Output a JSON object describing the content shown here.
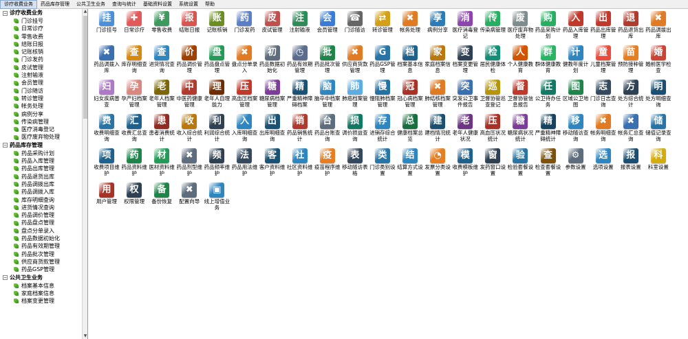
{
  "menubar": [
    {
      "label": "诊疗收费业务",
      "active": true
    },
    {
      "label": "药品库存管理",
      "active": false
    },
    {
      "label": "公共卫生业务",
      "active": false
    },
    {
      "label": "查询与统计",
      "active": false
    },
    {
      "label": "基础资料设置",
      "active": false
    },
    {
      "label": "系统设置",
      "active": false
    },
    {
      "label": "帮助",
      "active": false
    }
  ],
  "sidebar": {
    "groups": [
      {
        "title": "诊疗收费业务",
        "items": [
          "门诊挂号",
          "日常诊疗",
          "零售收费",
          "结账日报",
          "记账核销",
          "门诊发药",
          "皮试管理",
          "注射输液",
          "会员管理",
          "门诊随访",
          "转诊管理",
          "帐务处理",
          "病例分享",
          "传染病管理",
          "医疗消毒登记",
          "医疗废弃物处理"
        ]
      },
      {
        "title": "药品库存管理",
        "items": [
          "药品采购计划",
          "药品入库管理",
          "药品出库管理",
          "药品退货出库",
          "药品调拨出库",
          "药品调拨入库",
          "库存明细查询",
          "进货情况查询",
          "药品调价管理",
          "药品盘点管理",
          "盘点分单录入",
          "药品数据初始化",
          "药品有效期管理",
          "药品批次管理",
          "供应商货款管理",
          "药品GSP管理"
        ]
      },
      {
        "title": "公共卫生业务",
        "items": [
          "档案基本信息",
          "家庭档案信息",
          "档案变更管理"
        ]
      }
    ]
  },
  "tiles": [
    {
      "label": "门诊挂号",
      "icon": "register-icon",
      "color": "#4a90d9",
      "glyph": "挂"
    },
    {
      "label": "日常诊疗",
      "icon": "medical-kit-icon",
      "color": "#e05a5a",
      "glyph": "✚"
    },
    {
      "label": "零售收费",
      "icon": "cash-register-icon",
      "color": "#3c9a5f",
      "glyph": "¥"
    },
    {
      "label": "结账日报",
      "icon": "daily-report-icon",
      "color": "#d9534f",
      "glyph": "报"
    },
    {
      "label": "记账核销",
      "icon": "ledger-icon",
      "color": "#6b8e23",
      "glyph": "账"
    },
    {
      "label": "门诊发药",
      "icon": "pharmacist-icon",
      "color": "#5b7fc7",
      "glyph": "药"
    },
    {
      "label": "皮试管理",
      "icon": "skin-test-icon",
      "color": "#c0504d",
      "glyph": "皮"
    },
    {
      "label": "注射输液",
      "icon": "iv-drip-icon",
      "color": "#2e8b57",
      "glyph": "注"
    },
    {
      "label": "会员管理",
      "icon": "member-icon",
      "color": "#3a7bd5",
      "glyph": "会"
    },
    {
      "label": "门诊随访",
      "icon": "phone-icon",
      "color": "#666666",
      "glyph": "☎"
    },
    {
      "label": "转诊管理",
      "icon": "transfer-icon",
      "color": "#d4a017",
      "glyph": "⇄"
    },
    {
      "label": "帐务处理",
      "icon": "tools-icon",
      "color": "#e07b24",
      "glyph": "✖"
    },
    {
      "label": "病例分享",
      "icon": "share-icon",
      "color": "#2b7bb9",
      "glyph": "享"
    },
    {
      "label": "医疗消毒登记",
      "icon": "disinfect-icon",
      "color": "#8e44ad",
      "glyph": "消"
    },
    {
      "label": "传染病管理",
      "icon": "virus-icon",
      "color": "#27ae60",
      "glyph": "传"
    },
    {
      "label": "医疗废弃物处理",
      "icon": "trash-icon",
      "color": "#7f8c8d",
      "glyph": "废"
    },
    {
      "label": "药品采购计划",
      "icon": "cart-icon",
      "color": "#27ae60",
      "glyph": "购"
    },
    {
      "label": "药品入库管理",
      "icon": "stock-in-icon",
      "color": "#c0392b",
      "glyph": "入"
    },
    {
      "label": "药品出库管理",
      "icon": "stock-out-icon",
      "color": "#c0392b",
      "glyph": "出"
    },
    {
      "label": "药品退货出库",
      "icon": "return-icon",
      "color": "#b03a2e",
      "glyph": "退"
    },
    {
      "label": "药品调拨出库",
      "icon": "tools-icon",
      "color": "#e07b24",
      "glyph": "✖"
    },
    {
      "label": "药品调拨入库",
      "icon": "tools-icon",
      "color": "#3a6fb0",
      "glyph": "✖"
    },
    {
      "label": "库存明细查询",
      "icon": "search-icon",
      "color": "#d68910",
      "glyph": "查"
    },
    {
      "label": "进货情况查询",
      "icon": "search-icon",
      "color": "#2e86c1",
      "glyph": "查"
    },
    {
      "label": "药品调价管理",
      "icon": "price-icon",
      "color": "#a04000",
      "glyph": "价"
    },
    {
      "label": "药品盘点管理",
      "icon": "inventory-icon",
      "color": "#239b56",
      "glyph": "盘"
    },
    {
      "label": "盘点分单录入",
      "icon": "tools-icon",
      "color": "#e07b24",
      "glyph": "✖"
    },
    {
      "label": "药品数据初始化",
      "icon": "init-icon",
      "color": "#5d6d7e",
      "glyph": "初"
    },
    {
      "label": "药品有效期管理",
      "icon": "clock-icon",
      "color": "#5b6c8c",
      "glyph": "◷"
    },
    {
      "label": "药品批次管理",
      "icon": "batch-icon",
      "color": "#1e8449",
      "glyph": "批"
    },
    {
      "label": "供应商货款管理",
      "icon": "supplier-icon",
      "color": "#e07b24",
      "glyph": "✖"
    },
    {
      "label": "药品GSP管理",
      "icon": "gsp-icon",
      "color": "#2874a6",
      "glyph": "G"
    },
    {
      "label": "档案基本信息",
      "icon": "profile-icon",
      "color": "#1f618d",
      "glyph": "档"
    },
    {
      "label": "家庭档案信息",
      "icon": "family-icon",
      "color": "#b9770e",
      "glyph": "家"
    },
    {
      "label": "档案变更管理",
      "icon": "edit-profile-icon",
      "color": "#2e4053",
      "glyph": "变"
    },
    {
      "label": "居民健康体检",
      "icon": "checkup-icon",
      "color": "#148f77",
      "glyph": "检"
    },
    {
      "label": "个人健康教育",
      "icon": "person-icon",
      "color": "#d35400",
      "glyph": "人"
    },
    {
      "label": "群体健康教育",
      "icon": "group-icon",
      "color": "#28b463",
      "glyph": "群"
    },
    {
      "label": "健教年度计划",
      "icon": "plan-icon",
      "color": "#2e86c1",
      "glyph": "计"
    },
    {
      "label": "儿童档案管理",
      "icon": "child-icon",
      "color": "#e74c3c",
      "glyph": "童"
    },
    {
      "label": "预防接种管理",
      "icon": "vaccine-icon",
      "color": "#e67e22",
      "glyph": "苗"
    },
    {
      "label": "婚前医学检查",
      "icon": "wedding-icon",
      "color": "#cb4335",
      "glyph": "婚"
    },
    {
      "label": "妇女疾病普查",
      "icon": "women-icon",
      "color": "#af7ac5",
      "glyph": "妇"
    },
    {
      "label": "孕产妇档案管理",
      "icon": "maternal-icon",
      "color": "#d98880",
      "glyph": "孕"
    },
    {
      "label": "老年人档案管理",
      "icon": "elderly-icon",
      "color": "#7d6608",
      "glyph": "老"
    },
    {
      "label": "中医药健康管理",
      "icon": "tcm-icon",
      "color": "#b03a2e",
      "glyph": "中"
    },
    {
      "label": "老年人自理能力",
      "icon": "elderly-care-icon",
      "color": "#6e2c00",
      "glyph": "理"
    },
    {
      "label": "高血压档案管理",
      "icon": "hypertension-icon",
      "color": "#c0392b",
      "glyph": "压"
    },
    {
      "label": "糖尿病档案管理",
      "icon": "diabetes-icon",
      "color": "#7d3c98",
      "glyph": "糖"
    },
    {
      "label": "严重精神障碍档案",
      "icon": "mental-icon",
      "color": "#1a5276",
      "glyph": "精"
    },
    {
      "label": "脑卒中档案管理",
      "icon": "stroke-icon",
      "color": "#2e86c1",
      "glyph": "脑"
    },
    {
      "label": "肺癌档案管理",
      "icon": "lung-icon",
      "color": "#5dade2",
      "glyph": "肺"
    },
    {
      "label": "慢阻肺档案管理",
      "icon": "copd-icon",
      "color": "#2471a3",
      "glyph": "慢"
    },
    {
      "label": "冠心病档案管理",
      "icon": "heart-icon",
      "color": "#a93226",
      "glyph": "冠"
    },
    {
      "label": "肺结核档案管理",
      "icon": "tb-icon",
      "color": "#e07b24",
      "glyph": "✖"
    },
    {
      "label": "突发公卫事件报告",
      "icon": "emergency-icon",
      "color": "#3a6fb0",
      "glyph": "突"
    },
    {
      "label": "卫督协管巡查登记",
      "icon": "inspect-icon",
      "color": "#b7950b",
      "glyph": "巡"
    },
    {
      "label": "卫督协管信息报告",
      "icon": "report-icon",
      "color": "#c0392b",
      "glyph": "督"
    },
    {
      "label": "公卫待办任务",
      "icon": "task-icon",
      "color": "#117a65",
      "glyph": "任"
    },
    {
      "label": "区域公卫地图",
      "icon": "map-icon",
      "color": "#1e8449",
      "glyph": "图"
    },
    {
      "label": "门诊日志查询",
      "icon": "log-icon",
      "color": "#34495e",
      "glyph": "志"
    },
    {
      "label": "处方综合统计",
      "icon": "rx-stat-icon",
      "color": "#2e4053",
      "glyph": "方"
    },
    {
      "label": "处方明细查询",
      "icon": "rx-detail-icon",
      "color": "#1b4f72",
      "glyph": "明"
    },
    {
      "label": "收费明细查询",
      "icon": "fee-detail-icon",
      "color": "#2874a6",
      "glyph": "费"
    },
    {
      "label": "收费汇总查询",
      "icon": "fee-summary-icon",
      "color": "#1f618d",
      "glyph": "汇"
    },
    {
      "label": "患者消费统计",
      "icon": "patient-stat-icon",
      "color": "#922b21",
      "glyph": "患"
    },
    {
      "label": "收入综合统计",
      "icon": "income-icon",
      "color": "#b9770e",
      "glyph": "收"
    },
    {
      "label": "利润综合统计",
      "icon": "profit-icon",
      "color": "#2e4053",
      "glyph": "利"
    },
    {
      "label": "入库明细查询",
      "icon": "search-icon",
      "color": "#2e86c1",
      "glyph": "入"
    },
    {
      "label": "出库明细查询",
      "icon": "search-icon",
      "color": "#1a5276",
      "glyph": "出"
    },
    {
      "label": "药品销售统计",
      "icon": "sales-icon",
      "color": "#b03a2e",
      "glyph": "销"
    },
    {
      "label": "药品台账查询",
      "icon": "account-icon",
      "color": "#5d6d7e",
      "glyph": "台"
    },
    {
      "label": "调价损益查询",
      "icon": "pl-icon",
      "color": "#117864",
      "glyph": "损"
    },
    {
      "label": "进销存综合统计",
      "icon": "psi-icon",
      "color": "#2e86c1",
      "glyph": "存"
    },
    {
      "label": "健康档案总览",
      "icon": "overview-icon",
      "color": "#196f3d",
      "glyph": "总"
    },
    {
      "label": "建档情况统计",
      "icon": "archive-stat-icon",
      "color": "#1b4f72",
      "glyph": "建"
    },
    {
      "label": "老年人健康状况",
      "icon": "elderly-health-icon",
      "color": "#6c3483",
      "glyph": "老"
    },
    {
      "label": "高血压状况统计",
      "icon": "bp-stat-icon",
      "color": "#a93226",
      "glyph": "压"
    },
    {
      "label": "糖尿病状况统计",
      "icon": "dm-stat-icon",
      "color": "#7d3c98",
      "glyph": "糖"
    },
    {
      "label": "严重精神障碍统计",
      "icon": "mental-stat-icon",
      "color": "#154360",
      "glyph": "精"
    },
    {
      "label": "移动随访查询",
      "icon": "mobile-icon",
      "color": "#2e86c1",
      "glyph": "移"
    },
    {
      "label": "帐务明细查询",
      "icon": "tools-icon",
      "color": "#e07b24",
      "glyph": "✖"
    },
    {
      "label": "帐务汇总查询",
      "icon": "tools-icon",
      "color": "#3a6fb0",
      "glyph": "✖"
    },
    {
      "label": "储值记录查询",
      "icon": "deposit-icon",
      "color": "#2874a6",
      "glyph": "储"
    },
    {
      "label": "收费项目维护",
      "icon": "fee-item-icon",
      "color": "#1f618d",
      "glyph": "项"
    },
    {
      "label": "药品资料维护",
      "icon": "drug-data-icon",
      "color": "#1e8449",
      "glyph": "药"
    },
    {
      "label": "医材资料维护",
      "icon": "material-icon",
      "color": "#239b56",
      "glyph": "材"
    },
    {
      "label": "药品剂型维护",
      "icon": "tools-icon",
      "color": "#5d6d7e",
      "glyph": "✖"
    },
    {
      "label": "药品频率维护",
      "icon": "frequency-icon",
      "color": "#2e4053",
      "glyph": "频"
    },
    {
      "label": "药品用法维护",
      "icon": "usage-icon",
      "color": "#34495e",
      "glyph": "法"
    },
    {
      "label": "客户资料维护",
      "icon": "customer-icon",
      "color": "#1a5276",
      "glyph": "客"
    },
    {
      "label": "社区资料维护",
      "icon": "community-icon",
      "color": "#2e86c1",
      "glyph": "社"
    },
    {
      "label": "疫苗程序维护",
      "icon": "vaccine-program-icon",
      "color": "#e67e22",
      "glyph": "疫"
    },
    {
      "label": "移动随访表格",
      "icon": "mobile-form-icon",
      "color": "#34495e",
      "glyph": "表"
    },
    {
      "label": "门诊类别设置",
      "icon": "category-icon",
      "color": "#2874a6",
      "glyph": "类"
    },
    {
      "label": "结算方式设置",
      "icon": "settlement-icon",
      "color": "#2e86c1",
      "glyph": "结"
    },
    {
      "label": "发票分类设置",
      "icon": "invoice-pie-icon",
      "color": "#e67e22",
      "glyph": "◔"
    },
    {
      "label": "收费模板维护",
      "icon": "fee-template-icon",
      "color": "#1f618d",
      "glyph": "模"
    },
    {
      "label": "发药窗口设置",
      "icon": "window-icon",
      "color": "#2e4053",
      "glyph": "窗"
    },
    {
      "label": "检验套餐设置",
      "icon": "lab-package-icon",
      "color": "#2874a6",
      "glyph": "验"
    },
    {
      "label": "检查套餐设置",
      "icon": "exam-package-icon",
      "color": "#7e5109",
      "glyph": "查"
    },
    {
      "label": "参数设置",
      "icon": "settings-icon",
      "color": "#5d6d7e",
      "glyph": "⚙"
    },
    {
      "label": "选项设置",
      "icon": "options-icon",
      "color": "#2e86c1",
      "glyph": "选"
    },
    {
      "label": "报表设置",
      "icon": "report-settings-icon",
      "color": "#1b4f72",
      "glyph": "报"
    },
    {
      "label": "科室设置",
      "icon": "department-icon",
      "color": "#d4ac0d",
      "glyph": "科"
    },
    {
      "label": "用户管理",
      "icon": "user-icon",
      "color": "#a93226",
      "glyph": "用"
    },
    {
      "label": "权限管理",
      "icon": "permission-icon",
      "color": "#2e4053",
      "glyph": "权"
    },
    {
      "label": "备份恢复",
      "icon": "backup-icon",
      "color": "#1e8449",
      "glyph": "备"
    },
    {
      "label": "配置向导",
      "icon": "wizard-icon",
      "color": "#5d6d7e",
      "glyph": "✖"
    },
    {
      "label": "线上增值业务",
      "icon": "online-service-icon",
      "color": "#2e86c1",
      "glyph": "▣"
    }
  ]
}
